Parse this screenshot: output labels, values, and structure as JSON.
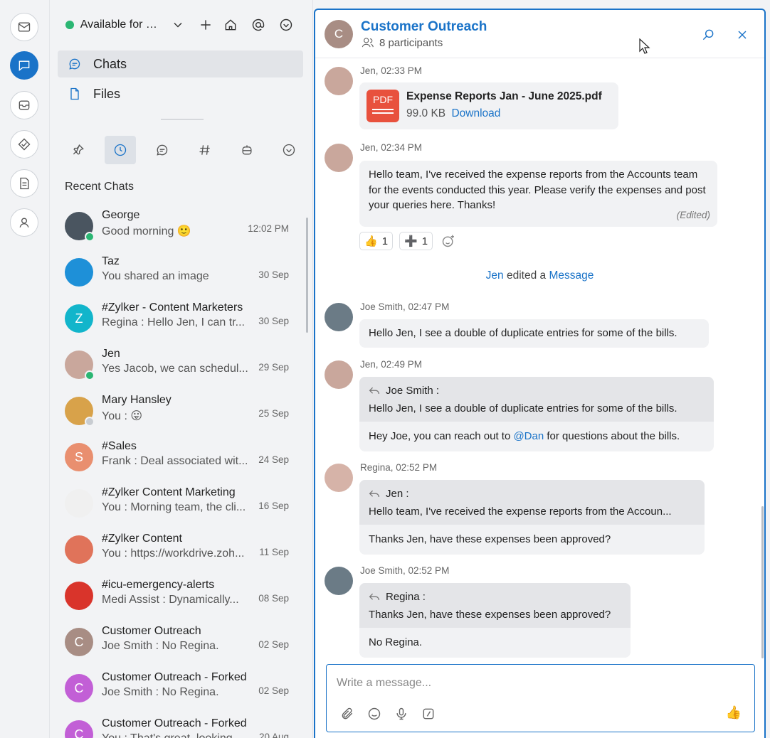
{
  "status": {
    "text": "Available for Chat"
  },
  "nav": [
    {
      "label": "Chats"
    },
    {
      "label": "Files"
    }
  ],
  "recent_title": "Recent Chats",
  "chats": [
    {
      "name": "George",
      "preview": "Good morning 🙂",
      "time": "12:02 PM",
      "avatar_color": "#4a5560",
      "presence": "#2bb673",
      "initial": ""
    },
    {
      "name": "Taz",
      "preview": "You shared an image",
      "time": "30 Sep",
      "avatar_color": "#1e90d8",
      "presence": "",
      "initial": ""
    },
    {
      "name": "#Zylker - Content Marketers",
      "preview": "Regina : Hello Jen, I can tr...",
      "time": "30 Sep",
      "avatar_color": "#12b5cb",
      "presence": "",
      "initial": "Z"
    },
    {
      "name": "Jen",
      "preview": "Yes Jacob, we can schedul...",
      "time": "29 Sep",
      "avatar_color": "#c9a79c",
      "presence": "#2bb673",
      "initial": ""
    },
    {
      "name": "Mary Hansley",
      "preview": "You : 😛",
      "time": "25 Sep",
      "avatar_color": "#d8a24a",
      "presence": "#c8ccd1",
      "initial": ""
    },
    {
      "name": "#Sales",
      "preview": "Frank : Deal associated wit...",
      "time": "24 Sep",
      "avatar_color": "#e98f6f",
      "presence": "",
      "initial": "S"
    },
    {
      "name": "#Zylker Content Marketing",
      "preview": "You : Morning team, the cli...",
      "time": "16 Sep",
      "avatar_color": "#f0f0f0",
      "presence": "",
      "initial": ""
    },
    {
      "name": "#Zylker Content",
      "preview": "You : https://workdrive.zoh...",
      "time": "11 Sep",
      "avatar_color": "#e0735a",
      "presence": "",
      "initial": ""
    },
    {
      "name": "#icu-emergency-alerts",
      "preview": "Medi Assist : Dynamically...",
      "time": "08 Sep",
      "avatar_color": "#d9342b",
      "presence": "",
      "initial": ""
    },
    {
      "name": "Customer Outreach",
      "preview": "Joe Smith : No Regina.",
      "time": "02 Sep",
      "avatar_color": "#a88d84",
      "presence": "",
      "initial": "C"
    },
    {
      "name": "Customer Outreach - Forked",
      "preview": "Joe Smith : No Regina.",
      "time": "02 Sep",
      "avatar_color": "#c25fd6",
      "presence": "",
      "initial": "C"
    },
    {
      "name": "Customer Outreach - Forked",
      "preview": "You : That's great, looking...",
      "time": "20 Aug",
      "avatar_color": "#c25fd6",
      "presence": "",
      "initial": "C"
    }
  ],
  "conversation": {
    "initial": "C",
    "title": "Customer Outreach",
    "participants": "8 participants",
    "messages": {
      "m1": {
        "meta": "Jen, 02:33 PM",
        "file_name": "Expense Reports Jan - June 2025.pdf",
        "file_size": "99.0 KB",
        "download": "Download",
        "file_badge": "PDF"
      },
      "m2": {
        "meta": "Jen, 02:34 PM",
        "text": "Hello team, I've received the expense reports from the Accounts team for the events conducted this year. Please verify the expenses and post your queries here. Thanks!",
        "edited": "(Edited)"
      },
      "reactions": [
        {
          "emoji": "👍",
          "count": "1"
        },
        {
          "emoji": "➕",
          "count": "1"
        }
      ],
      "system": {
        "actor": "Jen",
        "action": "edited a",
        "target": "Message"
      },
      "m3": {
        "meta": "Joe Smith, 02:47 PM",
        "text": "Hello Jen, I see a double of duplicate entries for some of the bills."
      },
      "m4": {
        "meta": "Jen, 02:49 PM",
        "quote_author": "Joe Smith :",
        "quote_text": "Hello Jen, I see a double of duplicate entries for some of the bills.",
        "reply_pre": "Hey Joe, you can reach out to ",
        "mention": "@Dan",
        "reply_post": " for questions about the bills."
      },
      "m5": {
        "meta": "Regina, 02:52 PM",
        "quote_author": "Jen :",
        "quote_text": "Hello team, I've received the expense reports from the Accoun...",
        "reply": "Thanks Jen, have these expenses been approved?"
      },
      "m6": {
        "meta": "Joe Smith, 02:52 PM",
        "quote_author": "Regina :",
        "quote_text": "Thanks Jen, have these expenses been approved?",
        "reply": "No Regina."
      }
    },
    "composer_placeholder": "Write a message...",
    "send_emoji": "👍"
  },
  "colors": {
    "accent": "#1a73c8",
    "online": "#2bb673",
    "pdf": "#e8513d"
  }
}
